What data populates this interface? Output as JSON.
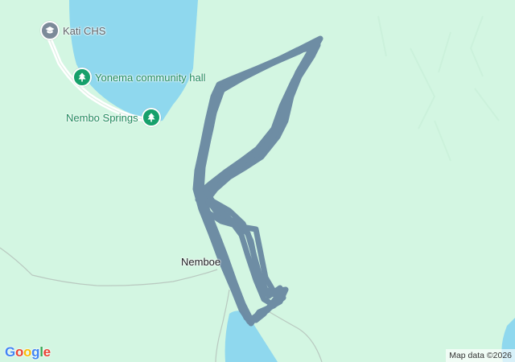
{
  "map": {
    "pois": [
      {
        "label": "Kati CHS",
        "type": "school",
        "icon": "school-icon",
        "color": "#7c8a99"
      },
      {
        "label": "Yonema community hall",
        "type": "park",
        "icon": "tree-icon",
        "color": "#16a06b"
      },
      {
        "label": "Nembo Springs",
        "type": "park",
        "icon": "tree-icon",
        "color": "#16a06b"
      }
    ],
    "town": {
      "label": "Nemboe"
    },
    "branding": {
      "logo_letters": [
        "G",
        "o",
        "o",
        "g",
        "l",
        "e"
      ],
      "logo_colors": [
        "#4285F4",
        "#EA4335",
        "#FBBC05",
        "#4285F4",
        "#34A853",
        "#EA4335"
      ]
    },
    "attribution": "Map data ©2026",
    "colors": {
      "land": "#d3f6e2",
      "water": "#8fd8ee",
      "road": "#ffffff",
      "route": "#6b8aa3"
    }
  }
}
